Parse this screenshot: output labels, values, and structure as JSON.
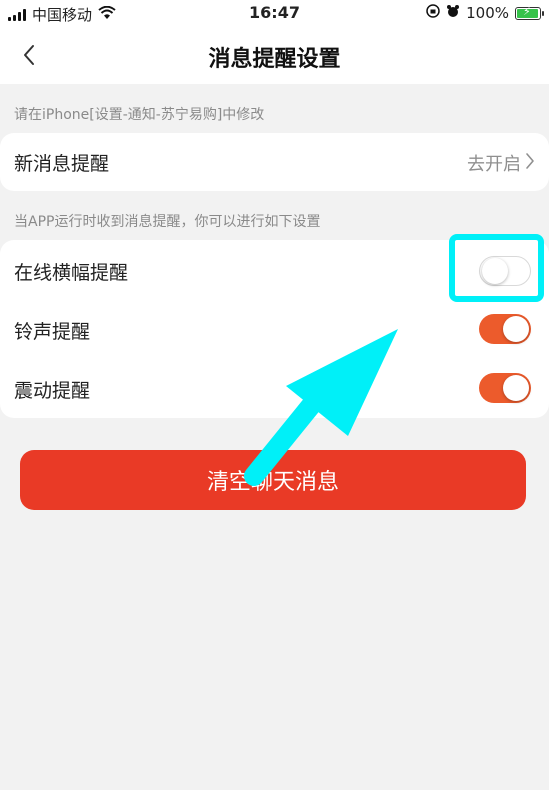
{
  "status_bar": {
    "carrier": "中国移动",
    "time": "16:47",
    "battery_percent": "100%"
  },
  "nav": {
    "title": "消息提醒设置"
  },
  "hint_top": "请在iPhone[设置-通知-苏宁易购]中修改",
  "new_message": {
    "label": "新消息提醒",
    "action": "去开启"
  },
  "hint_app": "当APP运行时收到消息提醒，你可以进行如下设置",
  "settings": [
    {
      "label": "在线横幅提醒",
      "on": false
    },
    {
      "label": "铃声提醒",
      "on": true
    },
    {
      "label": "震动提醒",
      "on": true
    }
  ],
  "clear_button": "清空聊天消息",
  "colors": {
    "accent": "#ec5b2c",
    "button": "#e93a26",
    "highlight": "#00f0f8"
  }
}
